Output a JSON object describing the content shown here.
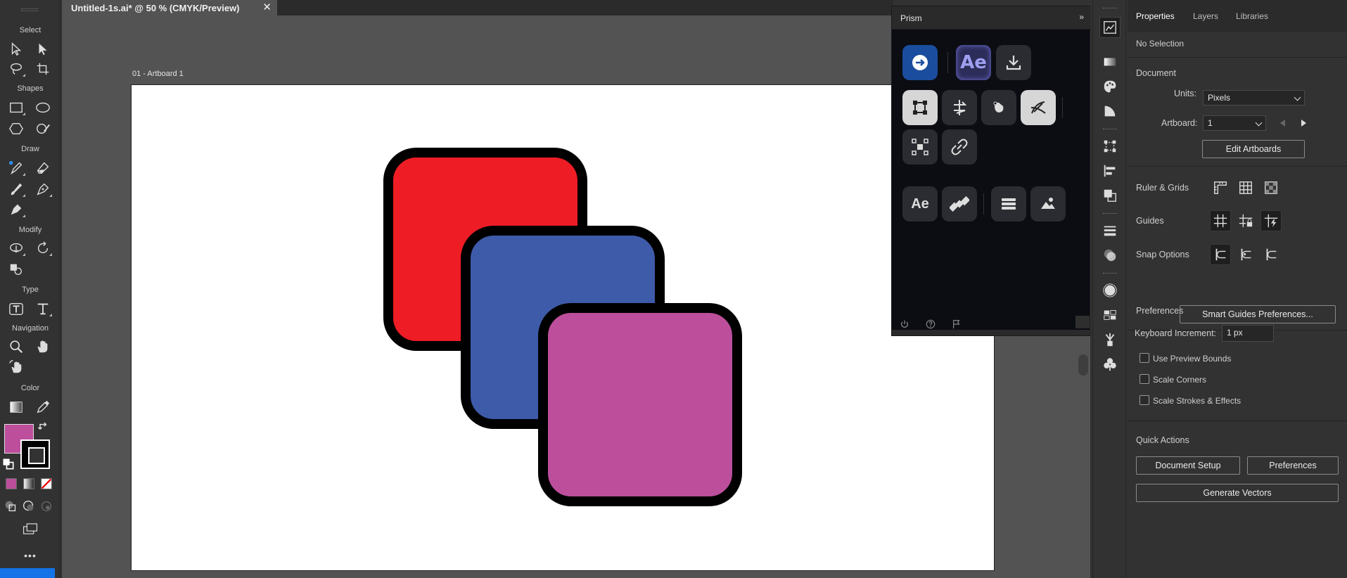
{
  "document": {
    "tab_title": "Untitled-1s.ai* @ 50 % (CMYK/Preview)",
    "close_glyph": "✕",
    "artboard_label": "01 - Artboard 1"
  },
  "toolbar": {
    "sections": [
      "Select",
      "Shapes",
      "Draw",
      "Modify",
      "Type",
      "Navigation",
      "Color"
    ],
    "more_glyph": "•••",
    "fill_color": "#bd4e9c",
    "stroke_color": "#000000"
  },
  "artwork": {
    "shapes": [
      {
        "name": "red-square",
        "fill": "#ee1c25",
        "stroke": "#000000"
      },
      {
        "name": "blue-square",
        "fill": "#3e5ba9",
        "stroke": "#000000"
      },
      {
        "name": "magenta-square",
        "fill": "#bd4e9c",
        "stroke": "#000000"
      }
    ]
  },
  "prism": {
    "title": "Prism",
    "collapse_glyph": "»",
    "ae_label": "Ae",
    "ae_small_label": "Ae"
  },
  "properties": {
    "tabs": [
      "Properties",
      "Layers",
      "Libraries"
    ],
    "active_tab": "Properties",
    "selection": "No Selection",
    "document_heading": "Document",
    "units_label": "Units:",
    "units_value": "Pixels",
    "artboard_label": "Artboard:",
    "artboard_value": "1",
    "edit_artboards": "Edit Artboards",
    "ruler_grids": "Ruler & Grids",
    "guides": "Guides",
    "snap_options": "Snap Options",
    "smart_guides_button": "Smart Guides Preferences...",
    "preferences_heading": "Preferences",
    "keyboard_increment_label": "Keyboard Increment:",
    "keyboard_increment_value": "1 px",
    "checkboxes": [
      "Use Preview Bounds",
      "Scale Corners",
      "Scale Strokes & Effects"
    ],
    "quick_actions_heading": "Quick Actions",
    "document_setup": "Document Setup",
    "preferences_button": "Preferences",
    "generate_vectors": "Generate Vectors"
  }
}
